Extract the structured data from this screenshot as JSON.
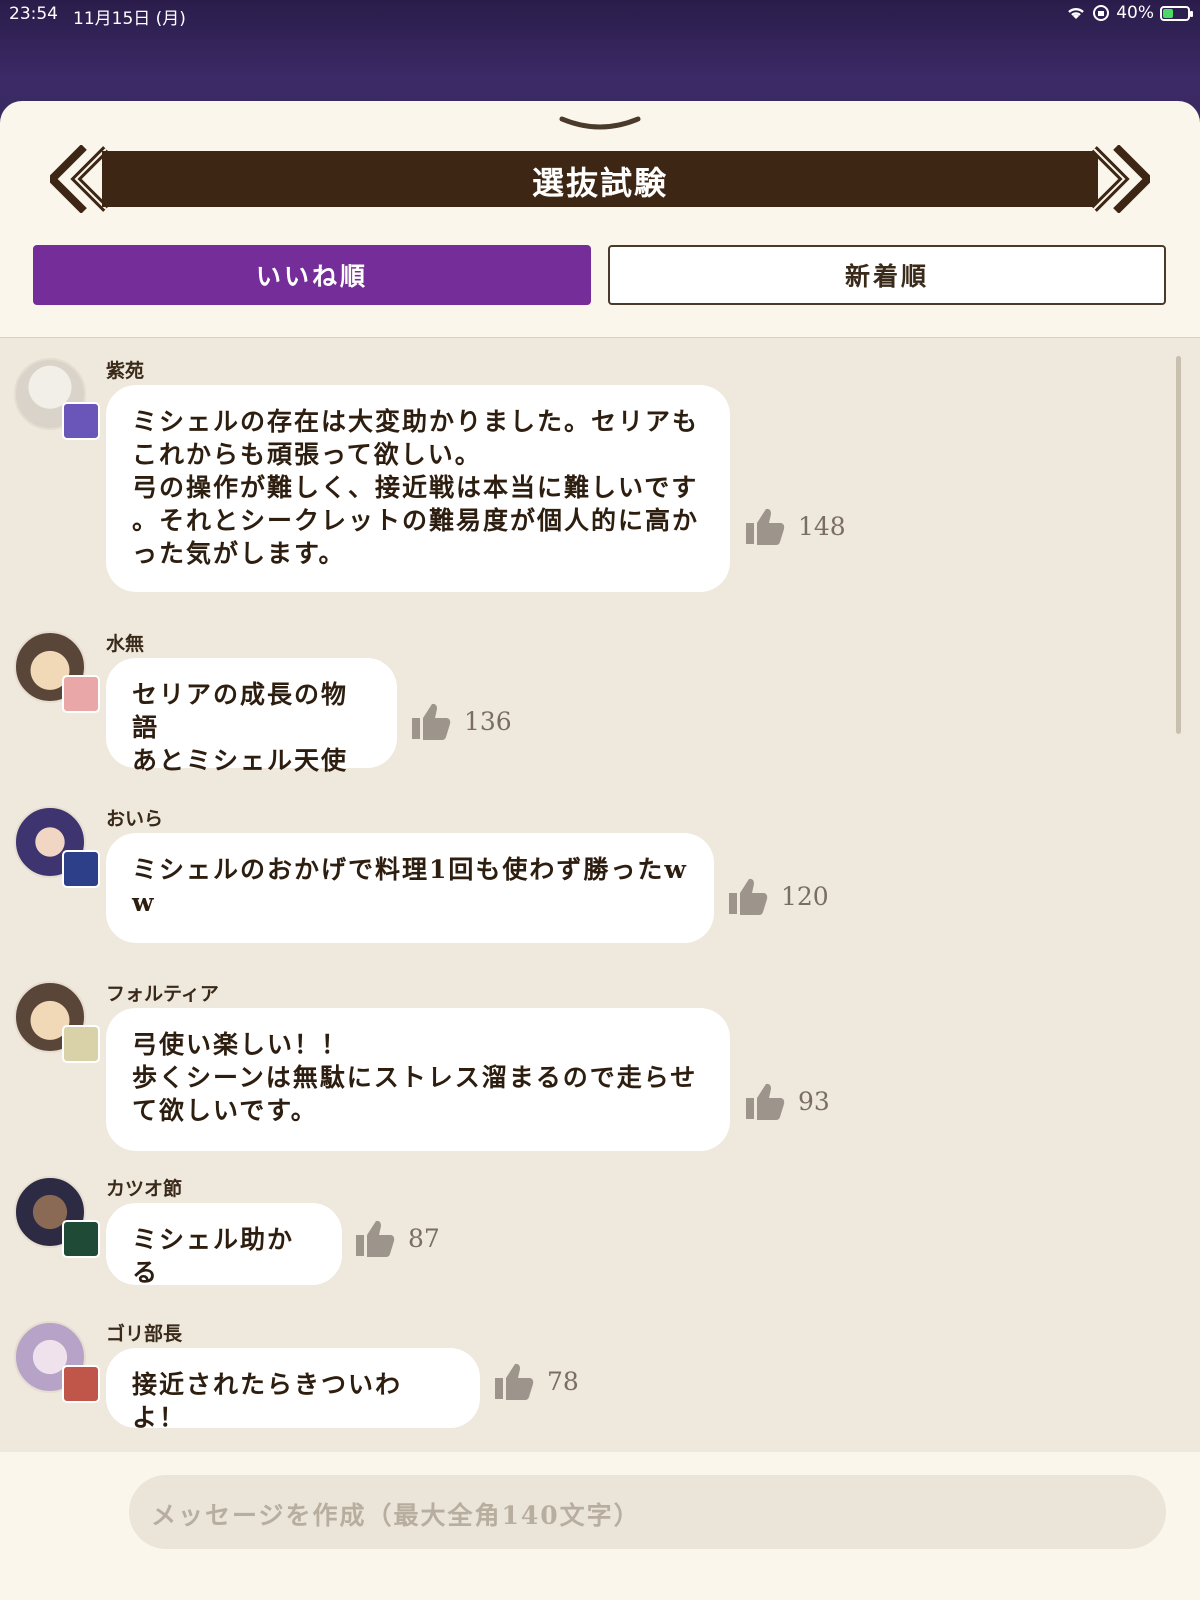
{
  "status": {
    "time": "23:54",
    "date": "11月15日 (月)",
    "battery": "40%"
  },
  "header": {
    "title": "選抜試験"
  },
  "tabs": [
    {
      "label": "いいね順",
      "active": true
    },
    {
      "label": "新着順",
      "active": false
    }
  ],
  "colors": {
    "accent": "#752d9a",
    "title_bar": "#3e2614",
    "list_bg": "#efe8dc"
  },
  "comments": [
    {
      "user": "紫苑",
      "text": "ミシェルの存在は大変助かりました。セリアも\nこれからも頑張って欲しい。\n弓の操作が難しく、接近戦は本当に難しいです\n。それとシークレットの難易度が個人的に高か\nった気がします。",
      "likes": "148"
    },
    {
      "user": "水無",
      "text": "セリアの成長の物語\nあとミシェル天使",
      "likes": "136"
    },
    {
      "user": "おいら",
      "text": "ミシェルのおかげで料理1回も使わず勝ったw\nw",
      "likes": "120"
    },
    {
      "user": "フォルティア",
      "text": "弓使い楽しい！！\n歩くシーンは無駄にストレス溜まるので走らせ\nて欲しいです。",
      "likes": "93"
    },
    {
      "user": "カツオ節",
      "text": "ミシェル助かる",
      "likes": "87"
    },
    {
      "user": "ゴリ部長",
      "text": "接近されたらきついわよ！",
      "likes": "78"
    }
  ],
  "input": {
    "placeholder": "メッセージを作成（最大全角140文字）"
  }
}
